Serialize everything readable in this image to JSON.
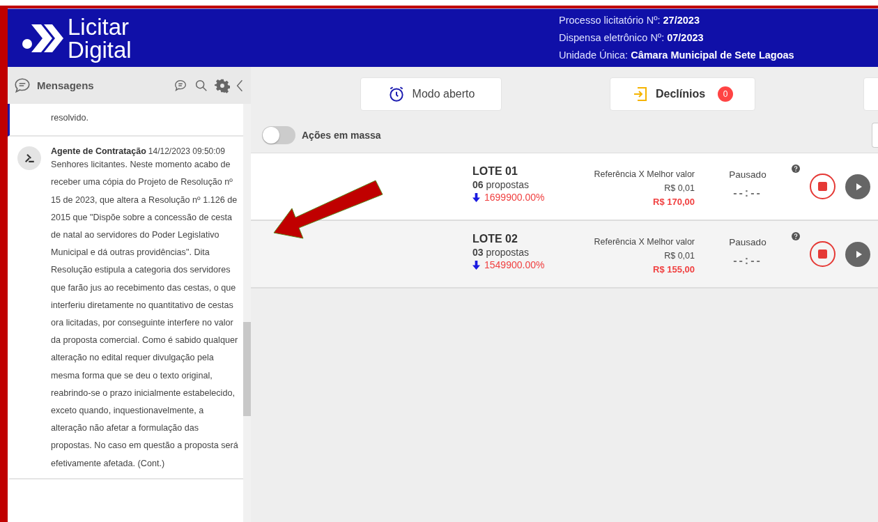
{
  "header": {
    "logo_text": [
      "Licitar",
      "Digital"
    ],
    "info": [
      "Processo licitatório Nº: **27/2023**",
      "Dispensa eletrônico Nº: **07/2023**",
      "Unidade Única: **Câmara Municipal de Sete Lagoas**"
    ]
  },
  "sidebar": {
    "title": "Mensagens",
    "messages": [
      {
        "selected": true,
        "text": "resolvido."
      },
      {
        "selected": false,
        "author": "Agente de Contratação",
        "time": "14/12/2023 09:50:09",
        "text": "Senhores licitantes. Neste momento acabo de receber uma cópia do Projeto de Resolução nº 15 de 2023, que altera a Resolução nº 1.126 de 2015 que \"Dispõe sobre a concessão de cesta de natal ao servidores do Poder Legislativo Municipal e dá outras providências\". Dita Resolução estipula a categoria dos servidores que farão jus ao recebimento das cestas, o que interferiu diretamente no quantitativo de cestas ora licitadas, por conseguinte interfere no valor da proposta comercial. Como é sabido qualquer alteração no edital requer divulgação pela mesma forma que se deu o texto original, reabrindo-se o prazo inicialmente estabelecido, exceto quando, inquestionavelmente, a alteração não afetar a formulação das propostas. No caso em questão a proposta será efetivamente afetada. (Cont.)"
      }
    ]
  },
  "toolbar": {
    "buttons": [
      {
        "kind": "timer",
        "label": "Modo aberto"
      },
      {
        "kind": "declines",
        "label": "Declínios",
        "badge": "0"
      }
    ]
  },
  "mass_actions": {
    "label": "Ações em massa",
    "on": false
  },
  "lots": [
    {
      "name": "LOTE 01",
      "proposals": "**06** propostas",
      "change": "1699900.00%",
      "ref_label": "Referência X Melhor valor",
      "ref_value": "R$ 0,01",
      "best_value": "R$ 170,00",
      "status": "Pausado",
      "timer": "--:--"
    },
    {
      "name": "LOTE 02",
      "proposals": "**03** propostas",
      "change": "1549900.00%",
      "ref_label": "Referência X Melhor valor",
      "ref_value": "R$ 0,01",
      "best_value": "R$ 155,00",
      "status": "Pausado",
      "timer": "--:--"
    }
  ]
}
